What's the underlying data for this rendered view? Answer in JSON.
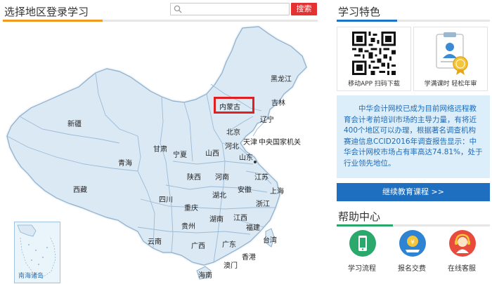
{
  "left_header": {
    "title": "选择地区登录学习",
    "search_placeholder": "",
    "search_button": "搜索"
  },
  "map": {
    "highlighted": "内蒙古",
    "inset_label": "南海诸岛",
    "provinces": [
      {
        "name": "黑龙江"
      },
      {
        "name": "吉林"
      },
      {
        "name": "内蒙古"
      },
      {
        "name": "辽宁"
      },
      {
        "name": "新疆"
      },
      {
        "name": "北京"
      },
      {
        "name": "天津"
      },
      {
        "name": "河北"
      },
      {
        "name": "甘肃"
      },
      {
        "name": "宁夏"
      },
      {
        "name": "山西"
      },
      {
        "name": "山东"
      },
      {
        "name": "中央国家机关"
      },
      {
        "name": "青海"
      },
      {
        "name": "陕西"
      },
      {
        "name": "河南"
      },
      {
        "name": "江苏"
      },
      {
        "name": "西藏"
      },
      {
        "name": "湖北"
      },
      {
        "name": "安徽"
      },
      {
        "name": "上海"
      },
      {
        "name": "四川"
      },
      {
        "name": "重庆"
      },
      {
        "name": "浙江"
      },
      {
        "name": "湖南"
      },
      {
        "name": "江西"
      },
      {
        "name": "贵州"
      },
      {
        "name": "福建"
      },
      {
        "name": "云南"
      },
      {
        "name": "广西"
      },
      {
        "name": "广东"
      },
      {
        "name": "台湾"
      },
      {
        "name": "香港"
      },
      {
        "name": "澳门"
      },
      {
        "name": "海南"
      }
    ]
  },
  "right": {
    "features_title": "学习特色",
    "feature_1_caption": "移动APP 扫码下载",
    "feature_2_caption": "学满课时 轻松年审",
    "intro": "中华会计网校已成为目前网络远程教育会计考前培训市场的主导力量，有将近400个地区可以办理，根据著名调查机构赛迪信息CCID2016年调查报告显示：中华会计网校市场占有率高达74.81%，处于行业领先地位。",
    "continue_button": "继续教育课程 >>",
    "help_title": "帮助中心",
    "help_items": [
      {
        "label": "学习流程"
      },
      {
        "label": "报名交费"
      },
      {
        "label": "在线客服"
      }
    ]
  },
  "colors": {
    "accent_orange": "#f29a1f",
    "accent_blue": "#1e74c6",
    "accent_green": "#2aa86a",
    "search_red": "#e43232",
    "map_fill": "#dbe9f5",
    "highlight_red": "#e02020"
  }
}
